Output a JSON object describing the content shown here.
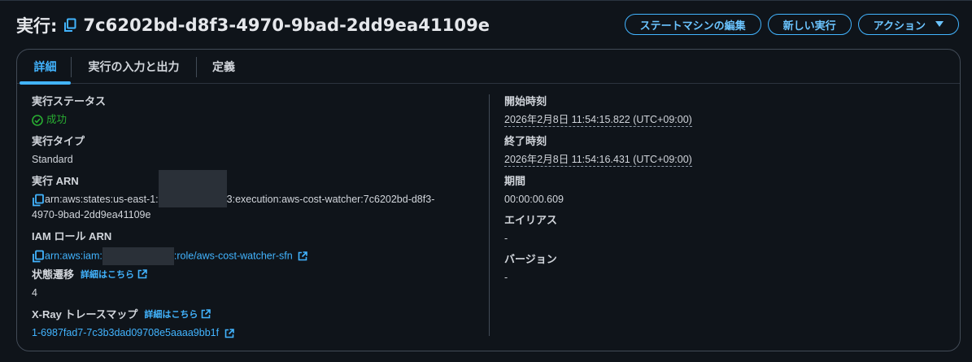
{
  "header": {
    "title_prefix": "実行:",
    "execution_id": "7c6202bd-d8f3-4970-9bad-2dd9ea41109e",
    "buttons": {
      "edit_state_machine": "ステートマシンの編集",
      "new_execution": "新しい実行",
      "actions": "アクション"
    }
  },
  "tabs": [
    {
      "label": "詳細",
      "active": true
    },
    {
      "label": "実行の入力と出力",
      "active": false
    },
    {
      "label": "定義",
      "active": false
    }
  ],
  "details": {
    "left": {
      "status": {
        "label": "実行ステータス",
        "value": "成功"
      },
      "type": {
        "label": "実行タイプ",
        "value": "Standard"
      },
      "arn": {
        "label": "実行 ARN",
        "part1": "arn:aws:states:us-east-1:",
        "part2": "3:execution:aws-cost-watcher:7c6202bd-d8f3-",
        "line2": "4970-9bad-2dd9ea41109e"
      },
      "iam_role": {
        "label": "IAM ロール ARN",
        "part1": "arn:aws:iam:",
        "part2": ":role/aws-cost-watcher-sfn"
      },
      "state_transitions": {
        "label": "状態遷移",
        "link": "詳細はこちら",
        "value": "4"
      },
      "xray": {
        "label": "X-Ray トレースマップ",
        "link": "詳細はこちら",
        "value": "1-6987fad7-7c3b3dad09708e5aaaa9bb1f"
      }
    },
    "right": {
      "start_time": {
        "label": "開始時刻",
        "value": "2026年2月8日 11:54:15.822 (UTC+09:00)"
      },
      "end_time": {
        "label": "終了時刻",
        "value": "2026年2月8日 11:54:16.431 (UTC+09:00)"
      },
      "duration": {
        "label": "期間",
        "value": "00:00:00.609"
      },
      "alias": {
        "label": "エイリアス",
        "value": "-"
      },
      "version": {
        "label": "バージョン",
        "value": "-"
      }
    }
  },
  "colors": {
    "accent": "#42b4ff",
    "success": "#29ad32",
    "background": "#0f141a",
    "border": "#424b57"
  },
  "icons": {
    "copy": "copy-icon",
    "external": "external-link-icon",
    "success": "check-circle-icon",
    "caret": "caret-down-icon"
  }
}
